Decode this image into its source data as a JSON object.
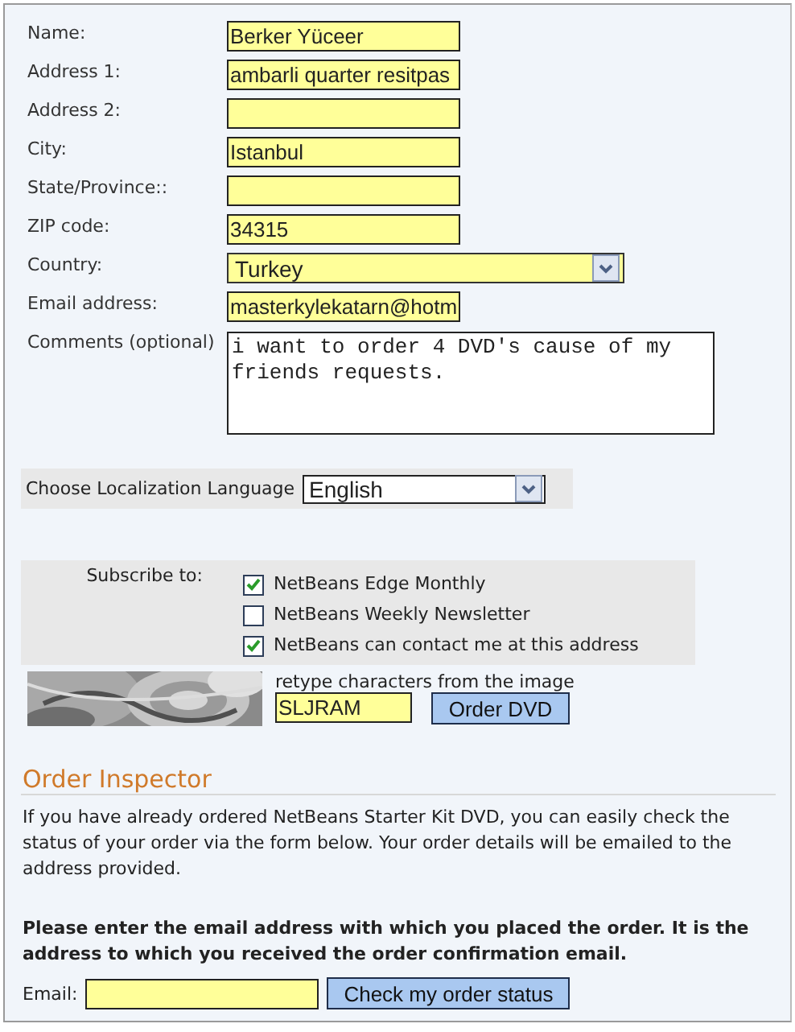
{
  "fields": [
    {
      "label": "Name:",
      "kind": "text",
      "value": "Berker Yüceer"
    },
    {
      "label": "Address 1:",
      "kind": "text",
      "value": "ambarli quarter resitpas"
    },
    {
      "label": "Address 2:",
      "kind": "text"
    },
    {
      "label": "City:",
      "kind": "text",
      "value": "Istanbul"
    },
    {
      "label": "State/Province::",
      "kind": "text"
    },
    {
      "label": "ZIP code:",
      "kind": "text",
      "value": "34315"
    },
    {
      "label": "Country:",
      "kind": "select",
      "value": "Turkey"
    },
    {
      "label": "Email address:",
      "kind": "text",
      "value": "masterkylekatarn@hotm"
    },
    {
      "label": "Comments (optional)",
      "kind": "textarea",
      "value": "i want to order 4 DVD's cause of my friends requests."
    }
  ],
  "language": {
    "label": "Choose Localization Language",
    "value": "English"
  },
  "subscribe": {
    "label": "Subscribe to:",
    "options": [
      {
        "label": "NetBeans Edge Monthly",
        "checked": true
      },
      {
        "label": "NetBeans Weekly Newsletter",
        "checked": false
      },
      {
        "label": "NetBeans can contact me at this address",
        "checked": true
      }
    ]
  },
  "captcha": {
    "kind": "picture",
    "prompt": "retype characters from the image",
    "value": "SLJRAM",
    "button": "Order DVD"
  },
  "order_inspector": {
    "title": "Order Inspector",
    "intro": "If you have already ordered NetBeans Starter Kit DVD, you can easily check the status of your order via the form below. Your order details will be emailed to the address provided.",
    "instruction": "Please enter the email address with which you placed the order. It is the address to which you received the order confirmation email.",
    "email_label": "Email:",
    "button": "Check my order status"
  }
}
